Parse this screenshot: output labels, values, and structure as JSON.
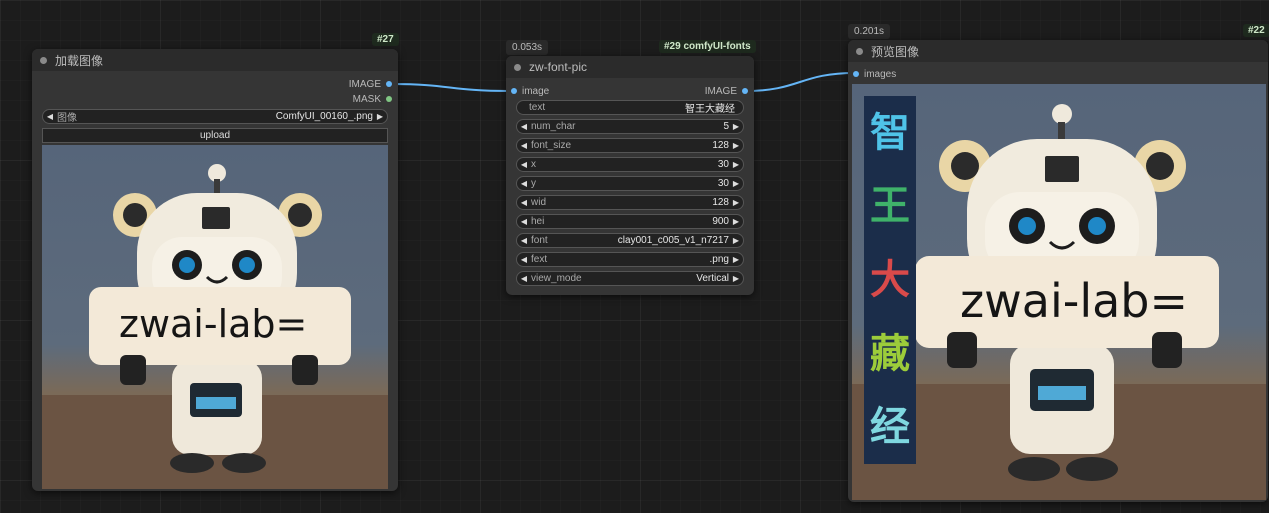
{
  "colors": {
    "canvas": "#1c1c1c",
    "node_body": "#353535",
    "node_header": "#2b2b2b",
    "image_link": "#64b5f6",
    "mask_link": "#81c784",
    "node_id_badge": "#1e2a1e"
  },
  "load_node": {
    "id": "#27",
    "title": "加载图像",
    "outputs": [
      "IMAGE",
      "MASK"
    ],
    "image_widget": {
      "label": "图像",
      "value": "ComfyUI_00160_.png"
    },
    "upload_label": "upload",
    "sign_text": "zwai-lab="
  },
  "font_node": {
    "id": "#29 comfyUI-fonts",
    "time": "0.053s",
    "title": "zw-font-pic",
    "input": "image",
    "output": "IMAGE",
    "text_widget": {
      "label": "text",
      "value": "智王大藏经"
    },
    "widgets": [
      {
        "label": "num_char",
        "value": "5"
      },
      {
        "label": "font_size",
        "value": "128"
      },
      {
        "label": "x",
        "value": "30"
      },
      {
        "label": "y",
        "value": "30"
      },
      {
        "label": "wid",
        "value": "128"
      },
      {
        "label": "hei",
        "value": "900"
      },
      {
        "label": "font",
        "value": "clay001_c005_v1_n7217"
      },
      {
        "label": "fext",
        "value": ".png"
      },
      {
        "label": "view_mode",
        "value": "Vertical"
      }
    ]
  },
  "preview_node": {
    "id": "#22",
    "time": "0.201s",
    "title": "预览图像",
    "input": "images",
    "sign_text": "zwai-lab=",
    "vertical_chars": [
      {
        "char": "智",
        "color": "#4fc3e8"
      },
      {
        "char": "王",
        "color": "#3fb26a"
      },
      {
        "char": "大",
        "color": "#d94a4a"
      },
      {
        "char": "藏",
        "color": "#9ccc3a"
      },
      {
        "char": "经",
        "color": "#7fd7e0"
      }
    ]
  }
}
